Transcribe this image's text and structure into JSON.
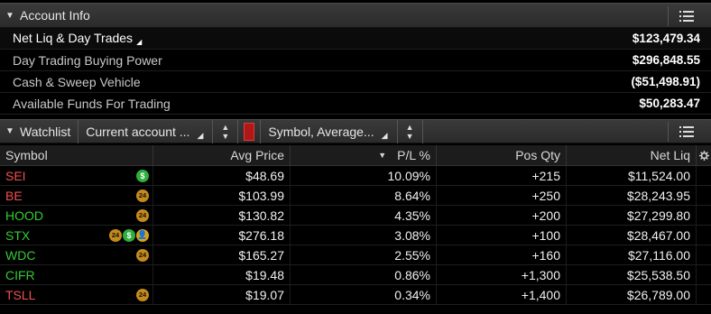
{
  "account": {
    "title": "Account Info",
    "rows": [
      {
        "label": "Net Liq & Day Trades",
        "value": "$123,479.34"
      },
      {
        "label": "Day Trading Buying Power",
        "value": "$296,848.55"
      },
      {
        "label": "Cash & Sweep Vehicle",
        "value": "($51,498.91)"
      },
      {
        "label": "Available Funds For Trading",
        "value": "$50,283.47"
      }
    ]
  },
  "watchlist": {
    "title": "Watchlist",
    "account_select": "Current account ...",
    "columns_select": "Symbol, Average..."
  },
  "table": {
    "headers": {
      "symbol": "Symbol",
      "avg_price": "Avg Price",
      "pl": "P/L %",
      "pos_qty": "Pos Qty",
      "net_liq": "Net Liq"
    },
    "rows": [
      {
        "symbol": "SEI",
        "avg": "$48.69",
        "pl": "10.09%",
        "qty": "+215",
        "net": "$11,524.00",
        "color": "#f05050"
      },
      {
        "symbol": "BE",
        "avg": "$103.99",
        "pl": "8.64%",
        "qty": "+250",
        "net": "$28,243.95",
        "color": "#f05050"
      },
      {
        "symbol": "HOOD",
        "avg": "$130.82",
        "pl": "4.35%",
        "qty": "+200",
        "net": "$27,299.80",
        "color": "#33cc33"
      },
      {
        "symbol": "STX",
        "avg": "$276.18",
        "pl": "3.08%",
        "qty": "+100",
        "net": "$28,467.00",
        "color": "#33cc33"
      },
      {
        "symbol": "WDC",
        "avg": "$165.27",
        "pl": "2.55%",
        "qty": "+160",
        "net": "$27,116.00",
        "color": "#33cc33"
      },
      {
        "symbol": "CIFR",
        "avg": "$19.48",
        "pl": "0.86%",
        "qty": "+1,300",
        "net": "$25,538.50",
        "color": "#33cc33"
      },
      {
        "symbol": "TSLL",
        "avg": "$19.07",
        "pl": "0.34%",
        "qty": "+1,400",
        "net": "$26,789.00",
        "color": "#f05050"
      }
    ]
  },
  "badge_text": {
    "b24": "24",
    "dollar": "$",
    "person": "👤"
  }
}
